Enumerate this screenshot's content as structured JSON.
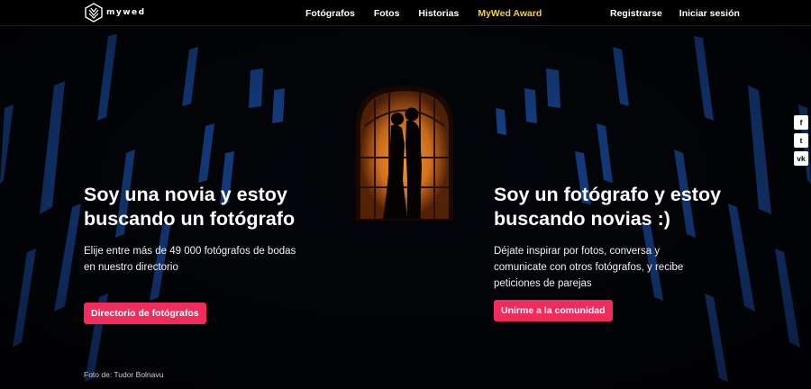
{
  "header": {
    "logo_text": "mywed",
    "nav": [
      {
        "label": "Fotógrafos"
      },
      {
        "label": "Fotos"
      },
      {
        "label": "Historias"
      },
      {
        "label": "MyWed Award"
      }
    ],
    "register": "Registrarse",
    "login": "Iniciar sesión"
  },
  "left": {
    "title": "Soy una novia y estoy buscando un fotógrafo",
    "text": "Elije entre más de 49 000 fotógrafos de bodas en nuestro directorio",
    "button": "Directorio de fotógrafos"
  },
  "right": {
    "title": "Soy un fotógrafo y estoy buscando novias :)",
    "text": "Déjate inspirar por fotos, conversa y comunicate con otros fotógrafos, y recibe peticiones de parejas",
    "button": "Unirme a la comunidad"
  },
  "credit": "Foto de: Tudor Bolnavu",
  "social": [
    {
      "icon": "facebook-icon",
      "glyph": "f"
    },
    {
      "icon": "twitter-icon",
      "glyph": "t"
    },
    {
      "icon": "vk-icon",
      "glyph": "vk"
    }
  ],
  "colors": {
    "accent": "#ef2c5c",
    "award": "#f7d02a",
    "window_glow": "#e58a2a",
    "stained_glass": "#2c6fd6"
  }
}
